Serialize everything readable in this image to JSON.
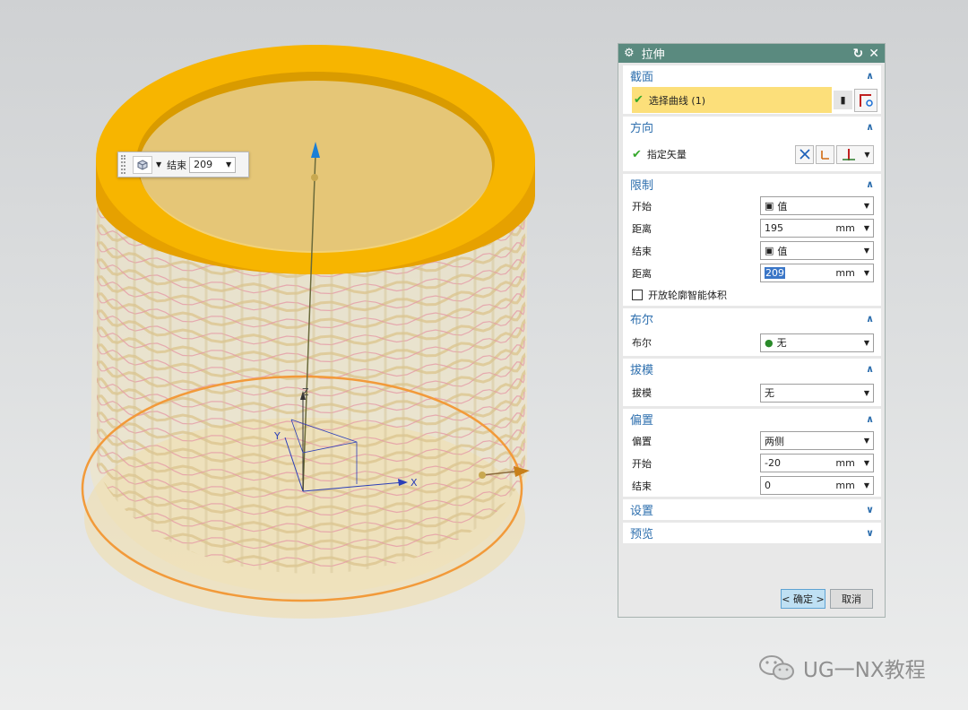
{
  "dialog": {
    "title": "拉伸",
    "sections": {
      "section": {
        "title": "截面",
        "select_curve": "选择曲线 (1)"
      },
      "direction": {
        "title": "方向",
        "specify_vector": "指定矢量"
      },
      "limits": {
        "title": "限制",
        "start_label": "开始",
        "start_value": "值",
        "distance1_label": "距离",
        "distance1_value": "195",
        "distance1_unit": "mm",
        "end_label": "结束",
        "end_value": "值",
        "distance2_label": "距离",
        "distance2_value": "209",
        "distance2_unit": "mm",
        "open_profile": "开放轮廓智能体积"
      },
      "boolean": {
        "title": "布尔",
        "label": "布尔",
        "value": "无"
      },
      "draft": {
        "title": "拔模",
        "label": "拔模",
        "value": "无"
      },
      "offset": {
        "title": "偏置",
        "offset_label": "偏置",
        "offset_value": "两侧",
        "start_label": "开始",
        "start_value": "-20",
        "start_unit": "mm",
        "end_label": "结束",
        "end_value": "0",
        "end_unit": "mm"
      },
      "settings": {
        "title": "设置"
      },
      "preview": {
        "title": "预览"
      }
    },
    "ok_button": "< 确定 >",
    "cancel_button": "取消"
  },
  "mini_toolbar": {
    "label": "结束",
    "value": "209"
  },
  "axes": {
    "x": "X",
    "y": "Y",
    "z": "Z"
  },
  "watermark": "UG一NX教程",
  "colors": {
    "ring": "#f7b500",
    "title_bar": "#5a8a7f",
    "section_title": "#2e6fae",
    "highlight": "#fcdf7a"
  }
}
